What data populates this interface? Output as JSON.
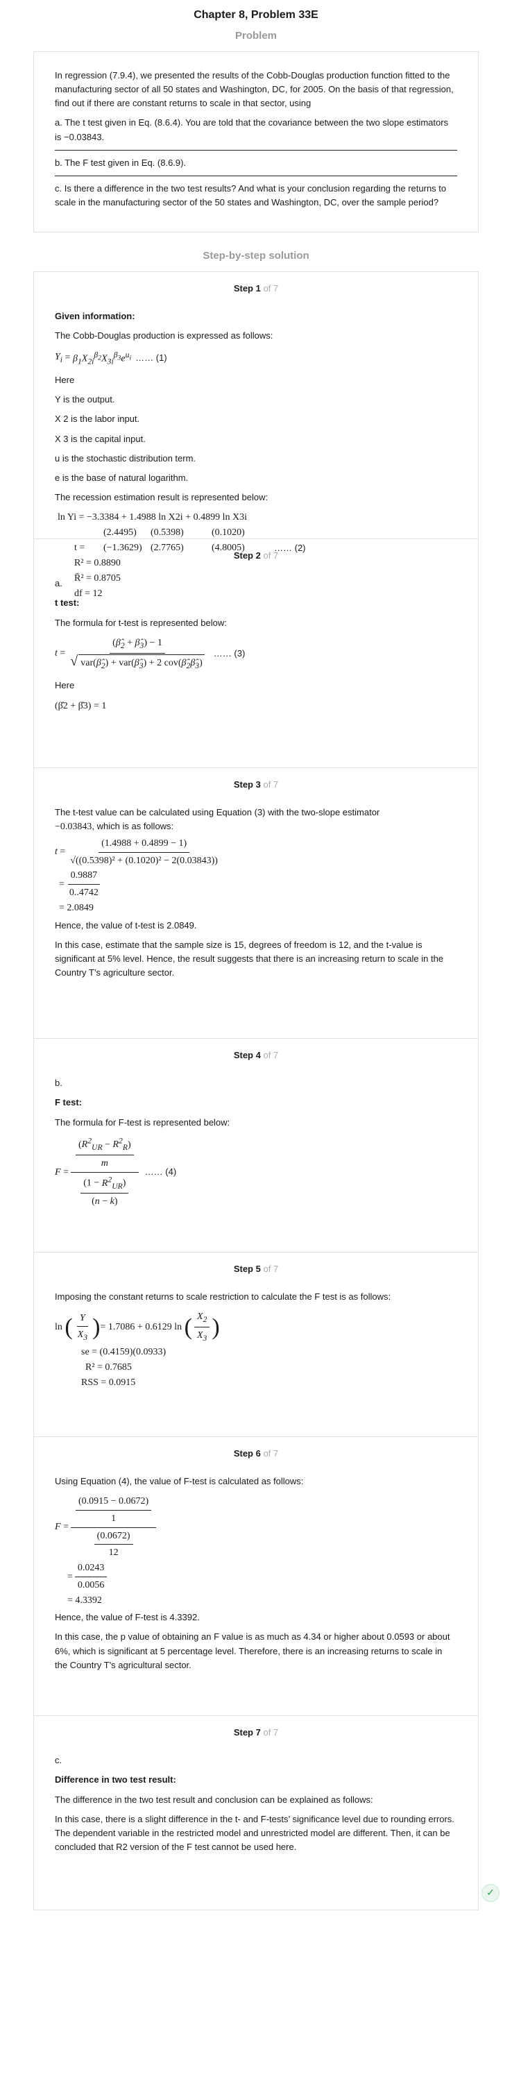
{
  "header": {
    "title": "Chapter 8, Problem 33E",
    "problem_label": "Problem",
    "solution_label": "Step-by-step solution"
  },
  "problem": {
    "intro": "In regression (7.9.4), we presented the results of the Cobb-Douglas production function fitted to the manufacturing sector of all 50 states and Washington, DC, for 2005. On the basis of that regression, find out if there are constant returns to scale in that sector, using",
    "part_a": "a. The t test given in Eq. (8.6.4). You are told that the covariance between the two slope estimators is −0.03843.",
    "part_b": "b. The F test given in Eq. (8.6.9).",
    "part_c": "c. Is there a difference in the two test results? And what is your conclusion regarding the returns to scale in the manufacturing sector of the 50 states and Washington, DC, over the sample period?"
  },
  "step_of": "of 7",
  "steps": [
    {
      "label": "Step 1",
      "given_heading": "Given information:",
      "cd_intro": "The Cobb-Douglas production is expressed as follows:",
      "eq1_tag": "…… (1)",
      "here": "Here",
      "def_y": "Y is the output.",
      "def_x2": "X 2 is the labor input.",
      "def_x3": "X 3 is the capital input.",
      "def_u": "u is the stochastic distribution term.",
      "def_e": "e is the base of natural logarithm.",
      "recession": "The recession estimation result is represented below:",
      "eq2_line1": "ln Yi = −3.3384 + 1.4988 ln X2i + 0.4899 ln X3i",
      "eq2_se": [
        "(2.4495)",
        "(0.5398)",
        "(0.1020)"
      ],
      "eq2_t_prefix": "t = ",
      "eq2_t": [
        "(−1.3629)",
        "(2.7765)",
        "(4.8005)"
      ],
      "eq2_tag": "…… (2)",
      "r2": "R² = 0.8890",
      "r2bar": "R̄² = 0.8705",
      "df": "df = 12"
    },
    {
      "label": "Step 2",
      "part": "a.",
      "heading": "t test:",
      "formula_intro": "The formula for t-test is represented below:",
      "eq3_tag": "…… (3)",
      "here": "Here",
      "here_eq": "(β̂2 + β̂3) = 1"
    },
    {
      "label": "Step 3",
      "intro_a": "The t-test value can be calculated using Equation (3) with the two-slope estimator",
      "intro_value": "−0.03843",
      "intro_b": ", which is as follows:",
      "num": "(1.4988 + 0.4899 − 1)",
      "den": "√((0.5398)² + (0.1020)² − 2(0.03843))",
      "line2_num": "0.9887",
      "line2_den": "0..4742",
      "line3": "= 2.0849",
      "result": "Hence, the value of t-test is 2.0849.",
      "conclusion": "In this case, estimate that the sample size is 15, degrees of freedom is 12, and the t-value is significant at 5% level. Hence, the result suggests that there is an increasing return to scale in the Country T’s agriculture sector."
    },
    {
      "label": "Step 4",
      "part": "b.",
      "heading": "F test:",
      "formula_intro": "The formula for F-test is represented below:",
      "eq4_tag": "…… (4)"
    },
    {
      "label": "Step 5",
      "intro": "Imposing the constant returns to scale restriction to calculate the F test is as follows:",
      "eq_rhs": "= 1.7086 + 0.6129 ln",
      "se": "se = (0.4159)(0.0933)",
      "r2": "R² = 0.7685",
      "rss": "RSS = 0.0915"
    },
    {
      "label": "Step 6",
      "intro": "Using Equation (4), the value of F-test is calculated as follows:",
      "num_top": "(0.0915 − 0.0672)",
      "num_bottom": "1",
      "den_top": "(0.0672)",
      "den_bottom": "12",
      "line2_num": "0.0243",
      "line2_den": "0.0056",
      "line3": "= 4.3392",
      "result": "Hence, the value of F-test is 4.3392.",
      "conclusion": "In this case, the p value of obtaining an F value is as much as 4.34 or higher about 0.0593 or about 6%, which is significant at 5 percentage level. Therefore, there is an increasing returns to scale in the Country T’s agricultural sector."
    },
    {
      "label": "Step 7",
      "part": "c.",
      "heading": "Difference in two test result:",
      "intro": "The difference in the two test result and conclusion can be explained as follows:",
      "body": "In this case, there is a slight difference in the t- and F-tests’ significance level due to rounding errors. The dependent variable in the restricted model and unrestricted model are different. Then, it can be concluded that R2 version of the F test cannot be used here."
    }
  ],
  "icons": {
    "shield": "shield-check-icon"
  }
}
